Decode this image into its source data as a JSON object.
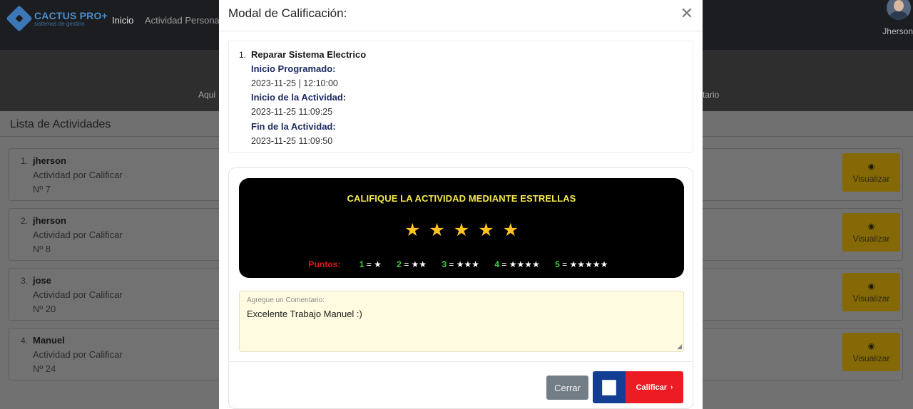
{
  "navbar": {
    "brand_name": "CACTUS PRO+",
    "brand_sub": "sistemas de gestión",
    "links": [
      "Inicio",
      "Actividad Persona"
    ],
    "user_name": "Jherson"
  },
  "band": {
    "left_text": "Aqui",
    "right_text": "tario"
  },
  "card": {
    "title": "Lista de Actividades",
    "items": [
      {
        "num": "1.",
        "name": "jherson",
        "desc": "Actividad por Calificar",
        "no": "Nº 7",
        "button": "Visualizar"
      },
      {
        "num": "2.",
        "name": "jherson",
        "desc": "Actividad por Calificar",
        "no": "Nº 8",
        "button": "Visualizar"
      },
      {
        "num": "3.",
        "name": "jose",
        "desc": "Actividad por Calificar",
        "no": "Nº 20",
        "button": "Visualizar"
      },
      {
        "num": "4.",
        "name": "Manuel",
        "desc": "Actividad por Calificar",
        "no": "Nº 24",
        "button": "Visualizar"
      }
    ]
  },
  "modal": {
    "title": "Modal de Calificación:",
    "activity": {
      "num": "1.",
      "title": "Reparar Sistema Electrico",
      "inicio_programado_label": "Inicio Programado:",
      "inicio_programado_value": "2023-11-25 | 12:10:00",
      "inicio_actividad_label": "Inicio de la Actividad:",
      "inicio_actividad_value": "2023-11-25 11:09:25",
      "fin_actividad_label": "Fin de la Actividad:",
      "fin_actividad_value": "2023-11-25 11:09:50"
    },
    "rating": {
      "heading": "CALIFIQUE LA ACTIVIDAD MEDIANTE ESTRELLAS",
      "stars_count": 5,
      "legend_label": "Puntos:",
      "legend": [
        {
          "n": "1",
          "stars": "★"
        },
        {
          "n": "2",
          "stars": "★★"
        },
        {
          "n": "3",
          "stars": "★★★"
        },
        {
          "n": "4",
          "stars": "★★★★"
        },
        {
          "n": "5",
          "stars": "★★★★★"
        }
      ]
    },
    "comment": {
      "label": "Agregue un Comentario:",
      "value": "Excelente Trabajo Manuel :)"
    },
    "buttons": {
      "cerrar": "Cerrar",
      "calificar": "Calificar"
    }
  },
  "colors": {
    "star": "#ffc31f",
    "heading": "#f7e94f",
    "calificar_red": "#ed1c24",
    "calificar_blue": "#143e94",
    "label_navy": "#1d2b62"
  }
}
